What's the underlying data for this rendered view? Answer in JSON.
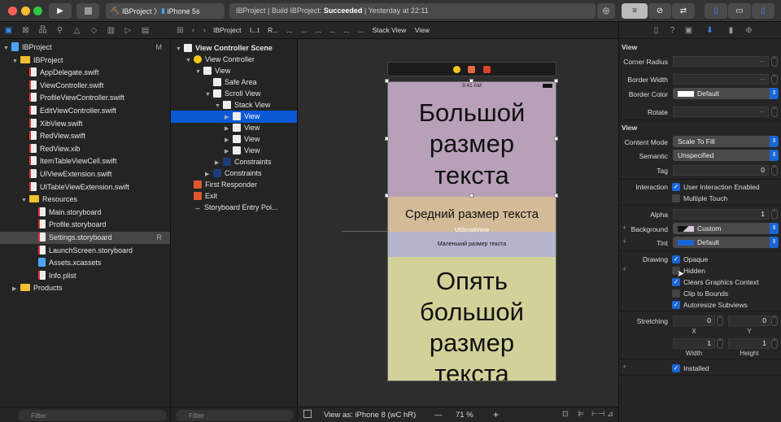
{
  "toolbar": {
    "scheme": "IBProject",
    "device": "iPhone 5s",
    "status_prefix": "IBProject | Build IBProject: ",
    "status_result": "Succeeded",
    "status_time": "| Yesterday at 22:11"
  },
  "jumpbar": {
    "items": [
      "IBProject",
      "I...t",
      "R...",
      "...",
      "...",
      "...",
      "...",
      "...",
      "...",
      "Stack View",
      "View"
    ]
  },
  "navigator": {
    "items": [
      {
        "label": "IBProject",
        "type": "project",
        "depth": 0,
        "badge": "M"
      },
      {
        "label": "IBProject",
        "type": "folder",
        "depth": 1
      },
      {
        "label": "AppDelegate.swift",
        "type": "file",
        "depth": 2
      },
      {
        "label": "ViewController.swift",
        "type": "file",
        "depth": 2
      },
      {
        "label": "ProfileViewController.swift",
        "type": "file",
        "depth": 2
      },
      {
        "label": "EditViewController.swift",
        "type": "file",
        "depth": 2
      },
      {
        "label": "XibView.swift",
        "type": "file",
        "depth": 2
      },
      {
        "label": "RedView.swift",
        "type": "file",
        "depth": 2
      },
      {
        "label": "RedView.xib",
        "type": "file",
        "depth": 2
      },
      {
        "label": "ItemTableViewCell.swift",
        "type": "file",
        "depth": 2
      },
      {
        "label": "UIViewExtension.swift",
        "type": "file",
        "depth": 2
      },
      {
        "label": "UITableViewExtension.swift",
        "type": "file",
        "depth": 2
      },
      {
        "label": "Resources",
        "type": "folder",
        "depth": 2
      },
      {
        "label": "Main.storyboard",
        "type": "file",
        "depth": 3
      },
      {
        "label": "Profile.storyboard",
        "type": "file",
        "depth": 3
      },
      {
        "label": "Settings.storyboard",
        "type": "file",
        "depth": 3,
        "badge": "R",
        "selected": true
      },
      {
        "label": "LaunchScreen.storyboard",
        "type": "file",
        "depth": 3
      },
      {
        "label": "Assets.xcassets",
        "type": "assets",
        "depth": 3
      },
      {
        "label": "Info.plist",
        "type": "file",
        "depth": 3
      },
      {
        "label": "Products",
        "type": "folder",
        "depth": 1,
        "collapsed": true
      }
    ],
    "filter_placeholder": "Filter"
  },
  "outline": {
    "items": [
      {
        "label": "View Controller Scene",
        "depth": 0,
        "bold": true
      },
      {
        "label": "View Controller",
        "depth": 1
      },
      {
        "label": "View",
        "depth": 2
      },
      {
        "label": "Safe Area",
        "depth": 3
      },
      {
        "label": "Scroll View",
        "depth": 3
      },
      {
        "label": "Stack View",
        "depth": 4
      },
      {
        "label": "View",
        "depth": 5,
        "selected": true
      },
      {
        "label": "View",
        "depth": 5
      },
      {
        "label": "View",
        "depth": 5
      },
      {
        "label": "View",
        "depth": 5
      },
      {
        "label": "Constraints",
        "depth": 4
      },
      {
        "label": "Constraints",
        "depth": 3
      },
      {
        "label": "First Responder",
        "depth": 1
      },
      {
        "label": "Exit",
        "depth": 1
      },
      {
        "label": "Storyboard Entry Poi...",
        "depth": 1
      }
    ],
    "filter_placeholder": "Filter"
  },
  "canvas": {
    "status_time": "9:41 AM",
    "large_text": "Большой размер текста",
    "medium_text": "Средний размер текста",
    "scroll_label": "UIScrollView",
    "small_text": "Маленький размер текста",
    "large_text_2": "Опять большой размер текста",
    "colors": {
      "purple": "#b8a0b9",
      "tan": "#d4bb98",
      "lavender": "#b4b4cc",
      "olive": "#d3d19a"
    },
    "view_as": "View as: iPhone 8 (wC hR)",
    "zoom_minus": "—",
    "zoom": "71 %",
    "zoom_plus": "+"
  },
  "inspector": {
    "section1": "View",
    "corner_radius_label": "Corner Radius",
    "corner_radius": "--",
    "border_width_label": "Border Width",
    "border_width": "--",
    "border_color_label": "Border Color",
    "border_color": "Default",
    "rotate_label": "Rotate",
    "rotate": "--",
    "section2": "View",
    "content_mode_label": "Content Mode",
    "content_mode": "Scale To Fill",
    "semantic_label": "Semantic",
    "semantic": "Unspecified",
    "tag_label": "Tag",
    "tag": "0",
    "interaction_label": "Interaction",
    "user_interaction": "User Interaction Enabled",
    "multiple_touch": "Multiple Touch",
    "alpha_label": "Alpha",
    "alpha": "1",
    "background_label": "Background",
    "background": "Custom",
    "tint_label": "Tint",
    "tint": "Default",
    "drawing_label": "Drawing",
    "opaque": "Opaque",
    "hidden": "Hidden",
    "clears": "Clears Graphics Context",
    "clip": "Clip to Bounds",
    "autoresize": "Autoresize Subviews",
    "stretching_label": "Stretching",
    "x": "0",
    "y": "0",
    "x_label": "X",
    "y_label": "Y",
    "width": "1",
    "height": "1",
    "width_label": "Width",
    "height_label": "Height",
    "installed": "Installed",
    "accent": "#1a66d6"
  }
}
